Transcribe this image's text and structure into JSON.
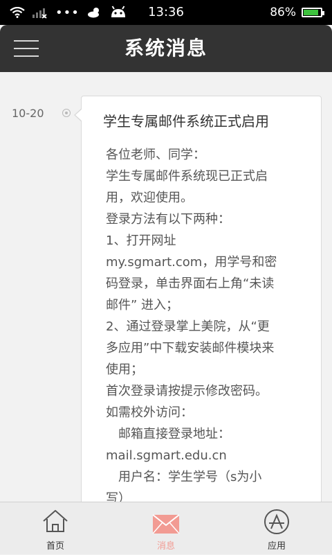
{
  "status_bar": {
    "time": "13:36",
    "battery": "86%",
    "battery_level": 0.86,
    "dots": "•••"
  },
  "header": {
    "title": "系统消息"
  },
  "message": {
    "date": "10-20",
    "title": "学生专属邮件系统正式启用",
    "body_lines": [
      "各位老师、同学：",
      "学生专属邮件系统现已正式启",
      "用，欢迎使用。",
      "登录方法有以下两种：",
      "1、打开网址",
      "my.sgmart.com，用学号和密",
      "码登录，单击界面右上角“未读",
      "邮件” 进入；",
      "2、通过登录掌上美院，从“更",
      "多应用”中下载安装邮件模块来",
      "使用；",
      "首次登录请按提示修改密码。",
      "如需校外访问：",
      "　邮箱直接登录地址：",
      "mail.sgmart.edu.cn",
      "　用户名：学生学号（s为小",
      "写）"
    ]
  },
  "bottom_nav": {
    "items": [
      {
        "label": "首页",
        "icon": "home-icon",
        "active": false
      },
      {
        "label": "消息",
        "icon": "mail-icon",
        "active": true
      },
      {
        "label": "应用",
        "icon": "app-store-icon",
        "active": false
      }
    ],
    "active_color": "#f29b93"
  }
}
